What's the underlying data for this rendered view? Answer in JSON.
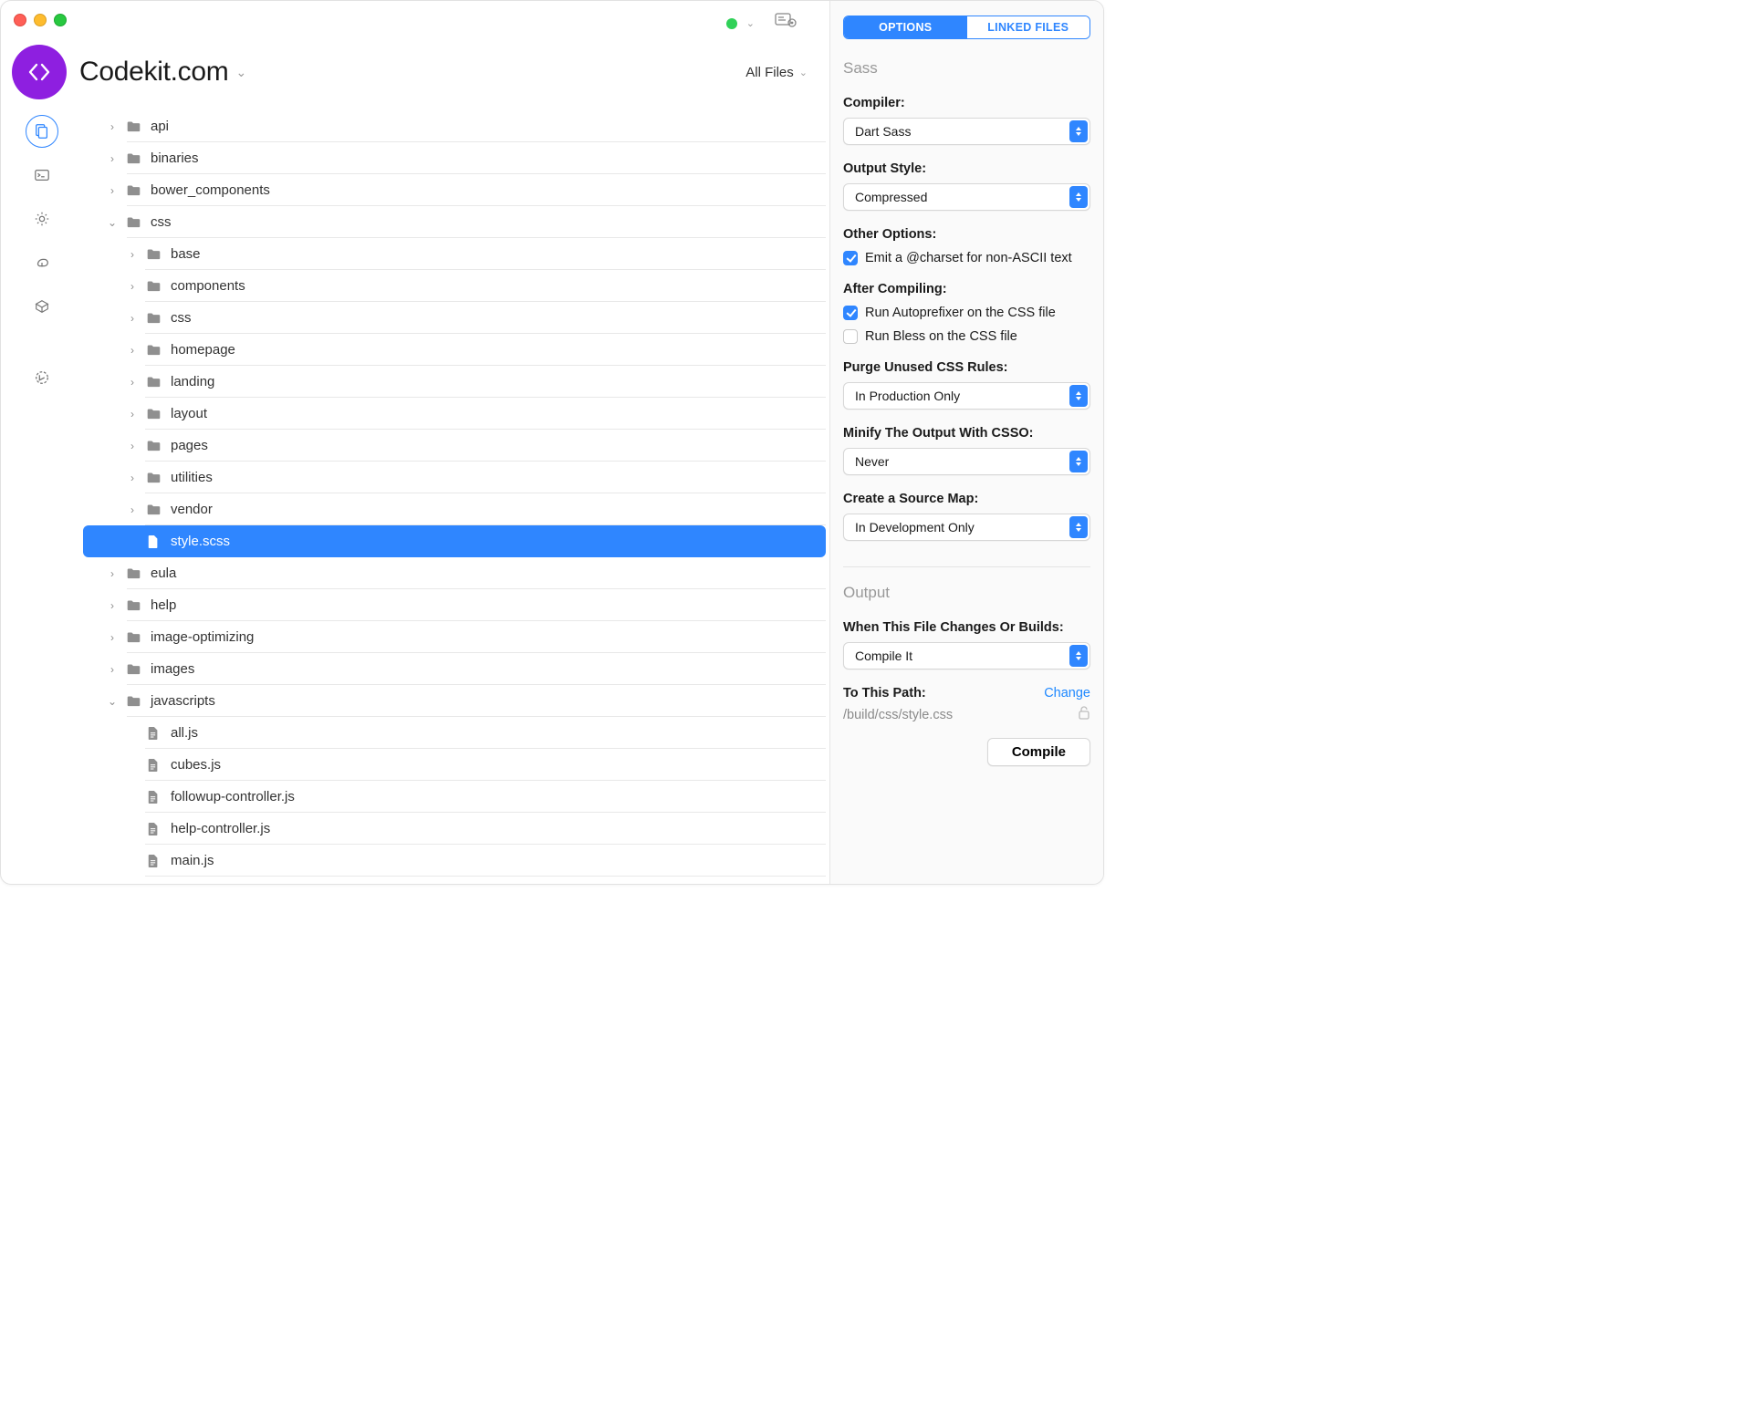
{
  "colors": {
    "accent": "#2f86ff",
    "purple": "#8e1fe0",
    "link": "#1e88ff"
  },
  "header": {
    "project_name": "Codekit.com",
    "filter_label": "All Files"
  },
  "sidebar_icons": [
    {
      "id": "files",
      "active": true
    },
    {
      "id": "terminal",
      "active": false
    },
    {
      "id": "settings",
      "active": false
    },
    {
      "id": "sync",
      "active": false
    },
    {
      "id": "package",
      "active": false
    },
    {
      "id": "history",
      "active": false
    }
  ],
  "files": [
    {
      "depth": 0,
      "type": "folder",
      "open": false,
      "name": "api"
    },
    {
      "depth": 0,
      "type": "folder",
      "open": false,
      "name": "binaries"
    },
    {
      "depth": 0,
      "type": "folder",
      "open": false,
      "name": "bower_components"
    },
    {
      "depth": 0,
      "type": "folder",
      "open": true,
      "name": "css"
    },
    {
      "depth": 1,
      "type": "folder",
      "open": false,
      "name": "base"
    },
    {
      "depth": 1,
      "type": "folder",
      "open": false,
      "name": "components"
    },
    {
      "depth": 1,
      "type": "folder",
      "open": false,
      "name": "css"
    },
    {
      "depth": 1,
      "type": "folder",
      "open": false,
      "name": "homepage"
    },
    {
      "depth": 1,
      "type": "folder",
      "open": false,
      "name": "landing"
    },
    {
      "depth": 1,
      "type": "folder",
      "open": false,
      "name": "layout"
    },
    {
      "depth": 1,
      "type": "folder",
      "open": false,
      "name": "pages"
    },
    {
      "depth": 1,
      "type": "folder",
      "open": false,
      "name": "utilities"
    },
    {
      "depth": 1,
      "type": "folder",
      "open": false,
      "name": "vendor"
    },
    {
      "depth": 1,
      "type": "file",
      "selected": true,
      "name": "style.scss"
    },
    {
      "depth": 0,
      "type": "folder",
      "open": false,
      "name": "eula"
    },
    {
      "depth": 0,
      "type": "folder",
      "open": false,
      "name": "help"
    },
    {
      "depth": 0,
      "type": "folder",
      "open": false,
      "name": "image-optimizing"
    },
    {
      "depth": 0,
      "type": "folder",
      "open": false,
      "name": "images"
    },
    {
      "depth": 0,
      "type": "folder",
      "open": true,
      "name": "javascripts"
    },
    {
      "depth": 1,
      "type": "file",
      "name": "all.js"
    },
    {
      "depth": 1,
      "type": "file",
      "name": "cubes.js"
    },
    {
      "depth": 1,
      "type": "file",
      "name": "followup-controller.js"
    },
    {
      "depth": 1,
      "type": "file",
      "name": "help-controller.js"
    },
    {
      "depth": 1,
      "type": "file",
      "name": "main.js"
    }
  ],
  "inspector": {
    "tabs": {
      "options": "OPTIONS",
      "linked": "LINKED FILES",
      "active": "options"
    },
    "sass": {
      "heading": "Sass",
      "compiler_label": "Compiler:",
      "compiler_value": "Dart Sass",
      "output_style_label": "Output Style:",
      "output_style_value": "Compressed",
      "other_options_label": "Other Options:",
      "charset_label": "Emit a @charset for non-ASCII text",
      "charset_checked": true,
      "after_compiling_label": "After Compiling:",
      "autoprefixer_label": "Run Autoprefixer on the CSS file",
      "autoprefixer_checked": true,
      "bless_label": "Run Bless on the CSS file",
      "bless_checked": false,
      "purge_label": "Purge Unused CSS Rules:",
      "purge_value": "In Production Only",
      "minify_label": "Minify The Output With CSSO:",
      "minify_value": "Never",
      "sourcemap_label": "Create a Source Map:",
      "sourcemap_value": "In Development Only"
    },
    "output": {
      "heading": "Output",
      "when_label": "When This File Changes Or Builds:",
      "when_value": "Compile It",
      "to_path_label": "To This Path:",
      "change_label": "Change",
      "path": "/build/css/style.css",
      "compile_button": "Compile"
    }
  }
}
